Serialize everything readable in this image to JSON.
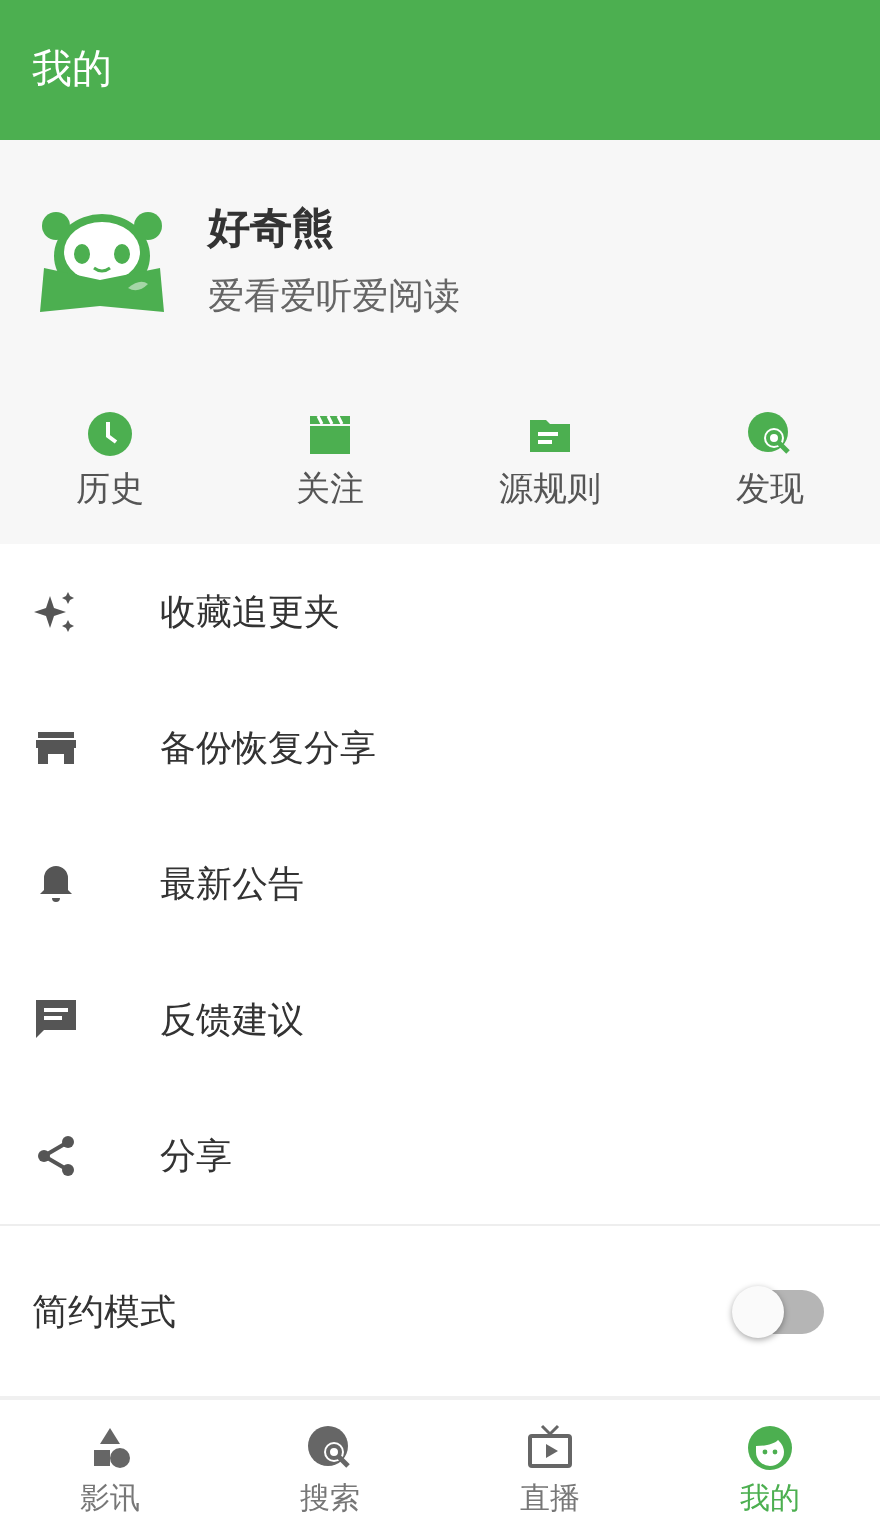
{
  "header": {
    "title": "我的"
  },
  "profile": {
    "name": "好奇熊",
    "motto": "爱看爱听爱阅读"
  },
  "shortcuts": [
    {
      "label": "历史"
    },
    {
      "label": "关注"
    },
    {
      "label": "源规则"
    },
    {
      "label": "发现"
    }
  ],
  "menu": [
    {
      "label": "收藏追更夹"
    },
    {
      "label": "备份恢复分享"
    },
    {
      "label": "最新公告"
    },
    {
      "label": "反馈建议"
    },
    {
      "label": "分享"
    }
  ],
  "settings": [
    {
      "label": "简约模式",
      "on": false
    }
  ],
  "bottom_nav": [
    {
      "label": "影讯",
      "selected": false
    },
    {
      "label": "搜索",
      "selected": false
    },
    {
      "label": "直播",
      "selected": false
    },
    {
      "label": "我的",
      "selected": true
    }
  ]
}
